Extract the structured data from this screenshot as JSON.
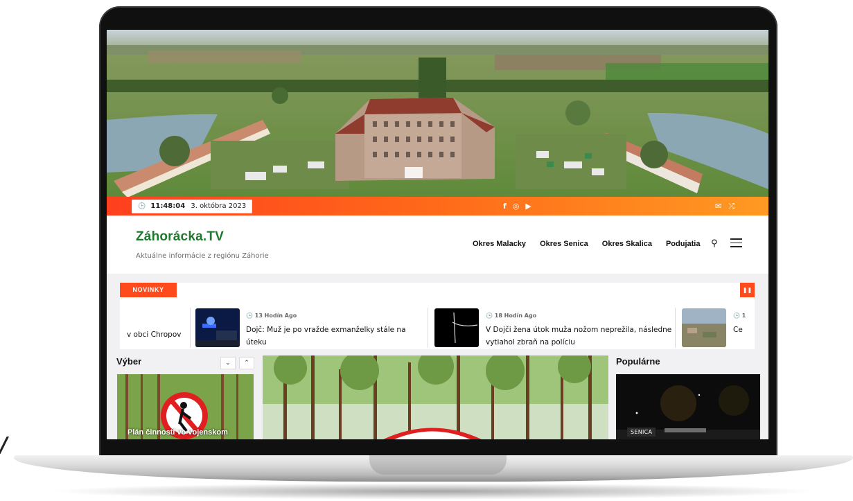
{
  "topbar": {
    "time": "11:48:04",
    "date": "3. októbra 2023",
    "social_icons": [
      "facebook-icon",
      "instagram-icon",
      "youtube-icon"
    ],
    "right_icons": [
      "mail-icon",
      "shuffle-icon"
    ],
    "gradient": [
      "#ff3f1e",
      "#ff9a22"
    ]
  },
  "header": {
    "site_title": "Záhorácka.TV",
    "tagline": "Aktuálne informácie z regiónu Záhorie",
    "title_color": "#1d7a2d",
    "nav": [
      "Okres Malacky",
      "Okres Senica",
      "Okres Skalica",
      "Podujatia"
    ]
  },
  "ticker": {
    "label": "NOVINKY",
    "accent": "#ff4a1c",
    "partial_left": "v obci Chropov",
    "items": [
      {
        "time": "13 Hodín Ago",
        "headline": "Dojč: Muž je po vražde exmanželky stále na úteku"
      },
      {
        "time": "18 Hodín Ago",
        "headline": "V Dojči žena útok muža nožom neprežila, následne vytiahol zbraň na políciu"
      },
      {
        "time": "1",
        "headline": "Ce"
      }
    ]
  },
  "sections": {
    "vyber_title": "Výber",
    "vyber_card_caption": "Plán činností vo vojenskom",
    "popularne_title": "Populárne",
    "popularne_badge": "SENICA"
  }
}
